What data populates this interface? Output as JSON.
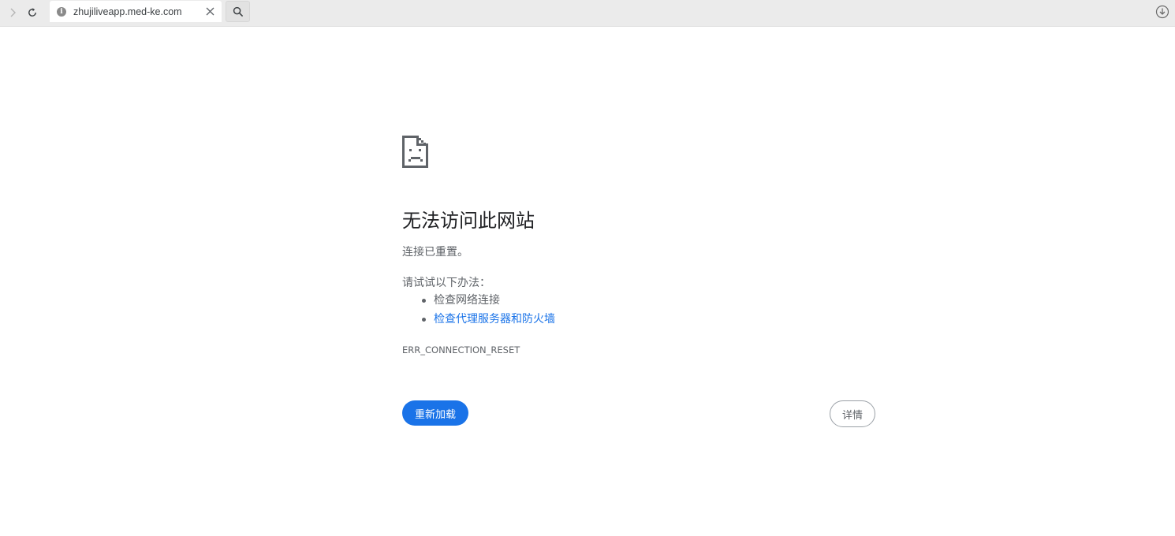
{
  "browser": {
    "tab": {
      "url": "zhujiliveapp.med-ke.com"
    }
  },
  "error_page": {
    "title": "无法访问此网站",
    "subtitle": "连接已重置。",
    "suggestions_heading": "请试试以下办法：",
    "suggestions": [
      {
        "label": "检查网络连接",
        "is_link": false
      },
      {
        "label": "检查代理服务器和防火墙",
        "is_link": true
      }
    ],
    "error_code": "ERR_CONNECTION_RESET",
    "reload_button_label": "重新加载",
    "details_button_label": "详情",
    "accent_color": "#1a73e8"
  }
}
